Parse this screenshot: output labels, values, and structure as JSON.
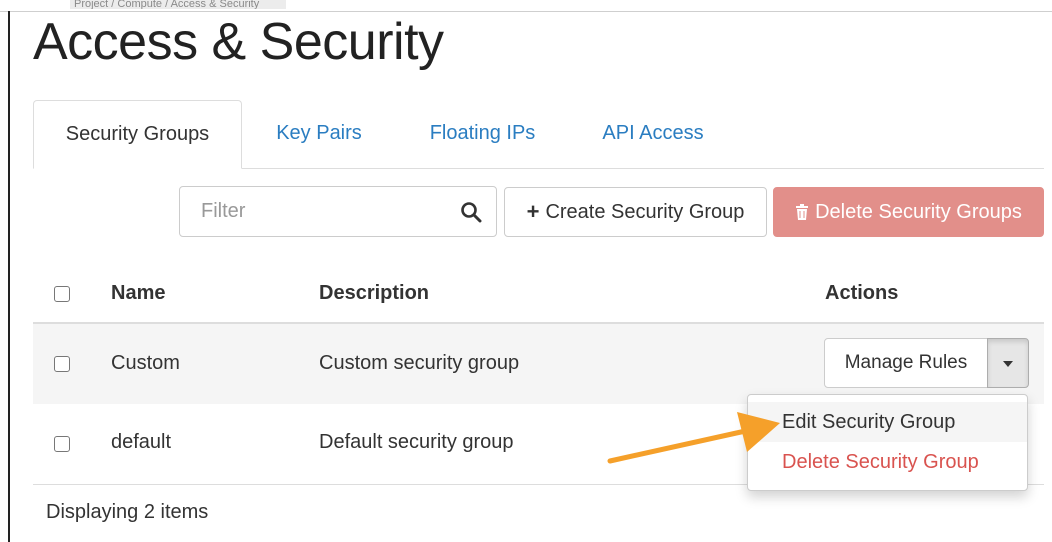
{
  "breadcrumb": "Project / Compute / Access & Security",
  "page": {
    "title": "Access & Security"
  },
  "tabs": [
    {
      "label": "Security Groups",
      "active": true
    },
    {
      "label": "Key Pairs",
      "active": false
    },
    {
      "label": "Floating IPs",
      "active": false
    },
    {
      "label": "API Access",
      "active": false
    }
  ],
  "toolbar": {
    "filter_placeholder": "Filter",
    "filter_value": "",
    "create_label": "Create Security Group",
    "delete_label": "Delete Security Groups"
  },
  "table": {
    "columns": {
      "name": "Name",
      "description": "Description",
      "actions": "Actions"
    },
    "rows": [
      {
        "name": "Custom",
        "description": "Custom security group",
        "action": "Manage Rules"
      },
      {
        "name": "default",
        "description": "Default security group",
        "action": ""
      }
    ],
    "footer": "Displaying 2 items"
  },
  "dropdown": {
    "items": [
      {
        "label": "Edit Security Group",
        "highlighted": true
      },
      {
        "label": "Delete Security Group",
        "danger": true
      }
    ]
  },
  "colors": {
    "link": "#2a7dc1",
    "danger": "#d9534f",
    "danger_button": "#e28f8a",
    "annotation_arrow": "#f5a02a"
  },
  "icons": [
    "search-icon",
    "plus-icon",
    "trash-icon",
    "caret-down-icon",
    "annotation-arrow"
  ]
}
